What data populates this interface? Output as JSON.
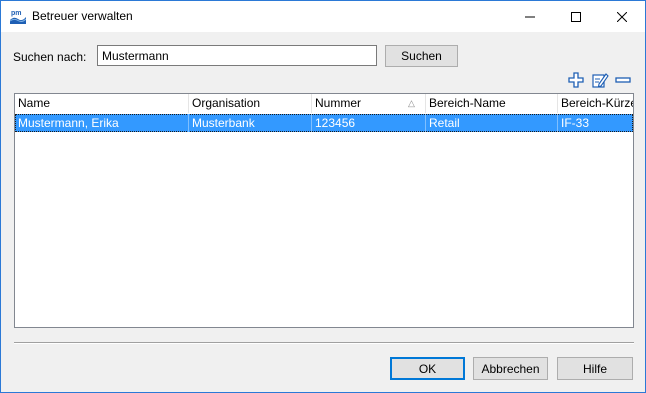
{
  "window": {
    "title": "Betreuer verwalten",
    "app_icon_text": "pm"
  },
  "search": {
    "label": "Suchen nach:",
    "value": "Mustermann",
    "button_label": "Suchen"
  },
  "toolbar": {
    "icons": [
      "add-icon",
      "edit-icon",
      "remove-icon"
    ]
  },
  "table": {
    "columns": [
      {
        "label": "Name"
      },
      {
        "label": "Organisation"
      },
      {
        "label": "Nummer",
        "sort": "ascending"
      },
      {
        "label": "Bereich-Name"
      },
      {
        "label": "Bereich-Kürzel"
      }
    ],
    "rows": [
      {
        "name": "Mustermann, Erika",
        "organisation": "Musterbank",
        "nummer": "123456",
        "bereich_name": "Retail",
        "bereich_kuerzel": "IF-33",
        "selected": true
      }
    ]
  },
  "buttons": {
    "ok": "OK",
    "cancel": "Abbrechen",
    "help": "Hilfe"
  },
  "colors": {
    "selection": "#3399ff",
    "accent": "#0078d7",
    "icon_blue": "#1e5fb4"
  }
}
